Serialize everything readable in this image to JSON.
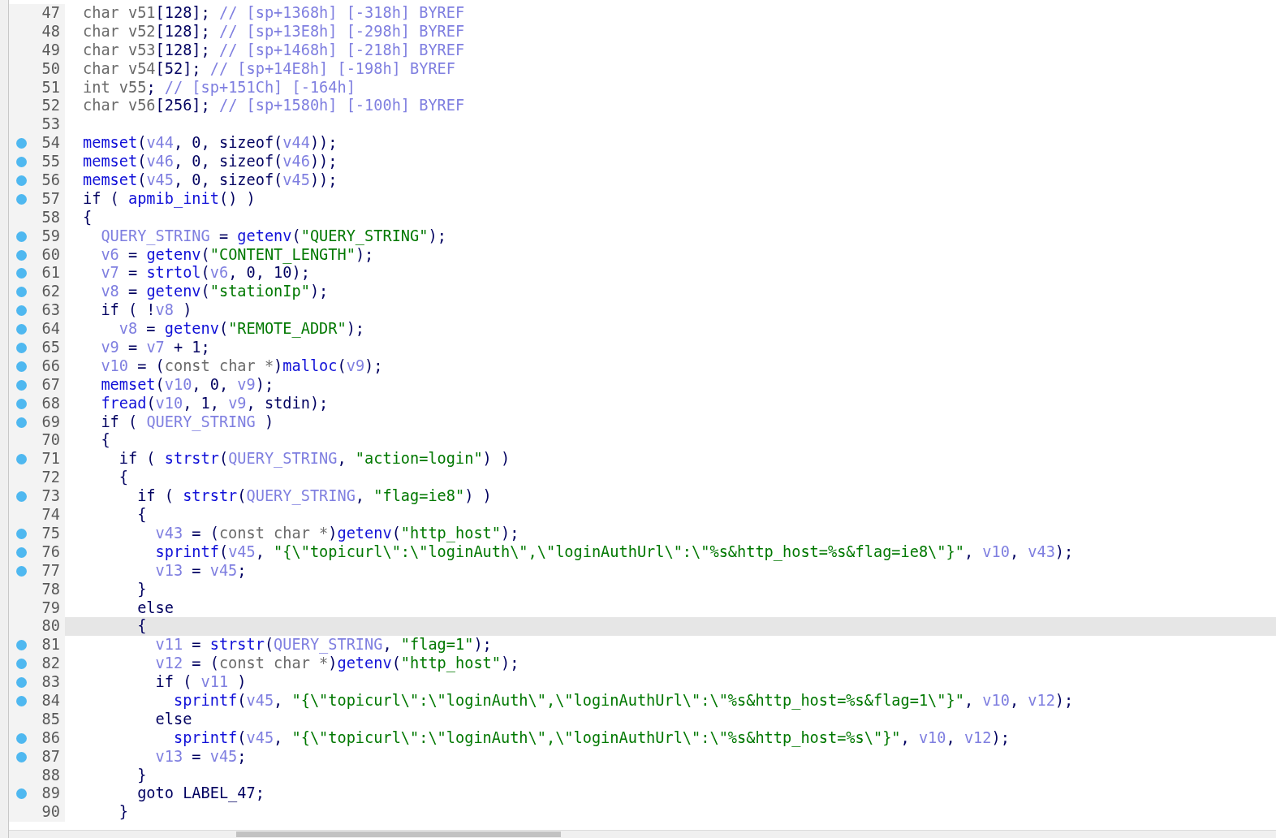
{
  "lines": [
    {
      "number": "47",
      "breakpoint": false,
      "selected": false,
      "code": [
        {
          "kind": "type",
          "text": "char v51"
        },
        {
          "kind": "plain",
          "text": "[128]; "
        },
        {
          "kind": "comment",
          "text": "// [sp+1368h] [-318h] BYREF"
        }
      ]
    },
    {
      "number": "48",
      "breakpoint": false,
      "selected": false,
      "code": [
        {
          "kind": "type",
          "text": "char v52"
        },
        {
          "kind": "plain",
          "text": "[128]; "
        },
        {
          "kind": "comment",
          "text": "// [sp+13E8h] [-298h] BYREF"
        }
      ]
    },
    {
      "number": "49",
      "breakpoint": false,
      "selected": false,
      "code": [
        {
          "kind": "type",
          "text": "char v53"
        },
        {
          "kind": "plain",
          "text": "[128]; "
        },
        {
          "kind": "comment",
          "text": "// [sp+1468h] [-218h] BYREF"
        }
      ]
    },
    {
      "number": "50",
      "breakpoint": false,
      "selected": false,
      "code": [
        {
          "kind": "type",
          "text": "char v54"
        },
        {
          "kind": "plain",
          "text": "[52]; "
        },
        {
          "kind": "comment",
          "text": "// [sp+14E8h] [-198h] BYREF"
        }
      ]
    },
    {
      "number": "51",
      "breakpoint": false,
      "selected": false,
      "code": [
        {
          "kind": "type",
          "text": "int v55"
        },
        {
          "kind": "plain",
          "text": "; "
        },
        {
          "kind": "comment",
          "text": "// [sp+151Ch] [-164h]"
        }
      ]
    },
    {
      "number": "52",
      "breakpoint": false,
      "selected": false,
      "code": [
        {
          "kind": "type",
          "text": "char v56"
        },
        {
          "kind": "plain",
          "text": "[256]; "
        },
        {
          "kind": "comment",
          "text": "// [sp+1580h] [-100h] BYREF"
        }
      ]
    },
    {
      "number": "53",
      "breakpoint": false,
      "selected": false
    },
    {
      "number": "54",
      "breakpoint": true,
      "selected": false,
      "code": [
        {
          "kind": "func",
          "text": "memset"
        },
        {
          "kind": "plain",
          "text": "("
        },
        {
          "kind": "var",
          "text": "v44"
        },
        {
          "kind": "plain",
          "text": ", 0, sizeof("
        },
        {
          "kind": "var",
          "text": "v44"
        },
        {
          "kind": "plain",
          "text": "));"
        }
      ]
    },
    {
      "number": "55",
      "breakpoint": true,
      "selected": false,
      "code": [
        {
          "kind": "func",
          "text": "memset"
        },
        {
          "kind": "plain",
          "text": "("
        },
        {
          "kind": "var",
          "text": "v46"
        },
        {
          "kind": "plain",
          "text": ", 0, sizeof("
        },
        {
          "kind": "var",
          "text": "v46"
        },
        {
          "kind": "plain",
          "text": "));"
        }
      ]
    },
    {
      "number": "56",
      "breakpoint": true,
      "selected": false,
      "code": [
        {
          "kind": "func",
          "text": "memset"
        },
        {
          "kind": "plain",
          "text": "("
        },
        {
          "kind": "var",
          "text": "v45"
        },
        {
          "kind": "plain",
          "text": ", 0, sizeof("
        },
        {
          "kind": "var",
          "text": "v45"
        },
        {
          "kind": "plain",
          "text": "));"
        }
      ]
    },
    {
      "number": "57",
      "breakpoint": true,
      "selected": false,
      "code": [
        {
          "kind": "plain",
          "text": "if ( "
        },
        {
          "kind": "func",
          "text": "apmib_init"
        },
        {
          "kind": "plain",
          "text": "() )"
        }
      ]
    },
    {
      "number": "58",
      "breakpoint": false,
      "selected": false,
      "code": [
        {
          "kind": "plain",
          "text": "{"
        }
      ]
    },
    {
      "number": "59",
      "breakpoint": true,
      "selected": false,
      "code": [
        {
          "kind": "var",
          "text": "  QUERY_STRING"
        },
        {
          "kind": "plain",
          "text": " = "
        },
        {
          "kind": "func",
          "text": "getenv"
        },
        {
          "kind": "plain",
          "text": "("
        },
        {
          "kind": "str",
          "text": "\"QUERY_STRING\""
        },
        {
          "kind": "plain",
          "text": ");"
        }
      ]
    },
    {
      "number": "60",
      "breakpoint": true,
      "selected": false,
      "code": [
        {
          "kind": "var",
          "text": "  v6"
        },
        {
          "kind": "plain",
          "text": " = "
        },
        {
          "kind": "func",
          "text": "getenv"
        },
        {
          "kind": "plain",
          "text": "("
        },
        {
          "kind": "str",
          "text": "\"CONTENT_LENGTH\""
        },
        {
          "kind": "plain",
          "text": ");"
        }
      ]
    },
    {
      "number": "61",
      "breakpoint": true,
      "selected": false,
      "code": [
        {
          "kind": "var",
          "text": "  v7"
        },
        {
          "kind": "plain",
          "text": " = "
        },
        {
          "kind": "func",
          "text": "strtol"
        },
        {
          "kind": "plain",
          "text": "("
        },
        {
          "kind": "var",
          "text": "v6"
        },
        {
          "kind": "plain",
          "text": ", 0, 10);"
        }
      ]
    },
    {
      "number": "62",
      "breakpoint": true,
      "selected": false,
      "code": [
        {
          "kind": "var",
          "text": "  v8"
        },
        {
          "kind": "plain",
          "text": " = "
        },
        {
          "kind": "func",
          "text": "getenv"
        },
        {
          "kind": "plain",
          "text": "("
        },
        {
          "kind": "str",
          "text": "\"stationIp\""
        },
        {
          "kind": "plain",
          "text": ");"
        }
      ]
    },
    {
      "number": "63",
      "breakpoint": true,
      "selected": false,
      "code": [
        {
          "kind": "plain",
          "text": "  if ( !"
        },
        {
          "kind": "var",
          "text": "v8"
        },
        {
          "kind": "plain",
          "text": " )"
        }
      ]
    },
    {
      "number": "64",
      "breakpoint": true,
      "selected": false,
      "code": [
        {
          "kind": "var",
          "text": "    v8"
        },
        {
          "kind": "plain",
          "text": " = "
        },
        {
          "kind": "func",
          "text": "getenv"
        },
        {
          "kind": "plain",
          "text": "("
        },
        {
          "kind": "str",
          "text": "\"REMOTE_ADDR\""
        },
        {
          "kind": "plain",
          "text": ");"
        }
      ]
    },
    {
      "number": "65",
      "breakpoint": true,
      "selected": false,
      "code": [
        {
          "kind": "var",
          "text": "  v9"
        },
        {
          "kind": "plain",
          "text": " = "
        },
        {
          "kind": "var",
          "text": "v7"
        },
        {
          "kind": "plain",
          "text": " + 1;"
        }
      ]
    },
    {
      "number": "66",
      "breakpoint": true,
      "selected": false,
      "code": [
        {
          "kind": "var",
          "text": "  v10"
        },
        {
          "kind": "plain",
          "text": " = ("
        },
        {
          "kind": "type",
          "text": "const char *"
        },
        {
          "kind": "plain",
          "text": ")"
        },
        {
          "kind": "func",
          "text": "malloc"
        },
        {
          "kind": "plain",
          "text": "("
        },
        {
          "kind": "var",
          "text": "v9"
        },
        {
          "kind": "plain",
          "text": ");"
        }
      ]
    },
    {
      "number": "67",
      "breakpoint": true,
      "selected": false,
      "code": [
        {
          "kind": "func",
          "text": "  memset"
        },
        {
          "kind": "plain",
          "text": "("
        },
        {
          "kind": "var",
          "text": "v10"
        },
        {
          "kind": "plain",
          "text": ", 0, "
        },
        {
          "kind": "var",
          "text": "v9"
        },
        {
          "kind": "plain",
          "text": ");"
        }
      ]
    },
    {
      "number": "68",
      "breakpoint": true,
      "selected": false,
      "code": [
        {
          "kind": "func",
          "text": "  fread"
        },
        {
          "kind": "plain",
          "text": "("
        },
        {
          "kind": "var",
          "text": "v10"
        },
        {
          "kind": "plain",
          "text": ", 1, "
        },
        {
          "kind": "var",
          "text": "v9"
        },
        {
          "kind": "plain",
          "text": ", stdin);"
        }
      ]
    },
    {
      "number": "69",
      "breakpoint": true,
      "selected": false,
      "code": [
        {
          "kind": "plain",
          "text": "  if ( "
        },
        {
          "kind": "var",
          "text": "QUERY_STRING"
        },
        {
          "kind": "plain",
          "text": " )"
        }
      ]
    },
    {
      "number": "70",
      "breakpoint": false,
      "selected": false,
      "code": [
        {
          "kind": "plain",
          "text": "  {"
        }
      ]
    },
    {
      "number": "71",
      "breakpoint": true,
      "selected": false,
      "code": [
        {
          "kind": "plain",
          "text": "    if ( "
        },
        {
          "kind": "func",
          "text": "strstr"
        },
        {
          "kind": "plain",
          "text": "("
        },
        {
          "kind": "var",
          "text": "QUERY_STRING"
        },
        {
          "kind": "plain",
          "text": ", "
        },
        {
          "kind": "str",
          "text": "\"action=login\""
        },
        {
          "kind": "plain",
          "text": ") )"
        }
      ]
    },
    {
      "number": "72",
      "breakpoint": false,
      "selected": false,
      "code": [
        {
          "kind": "plain",
          "text": "    {"
        }
      ]
    },
    {
      "number": "73",
      "breakpoint": true,
      "selected": false,
      "code": [
        {
          "kind": "plain",
          "text": "      if ( "
        },
        {
          "kind": "func",
          "text": "strstr"
        },
        {
          "kind": "plain",
          "text": "("
        },
        {
          "kind": "var",
          "text": "QUERY_STRING"
        },
        {
          "kind": "plain",
          "text": ", "
        },
        {
          "kind": "str",
          "text": "\"flag=ie8\""
        },
        {
          "kind": "plain",
          "text": ") )"
        }
      ]
    },
    {
      "number": "74",
      "breakpoint": false,
      "selected": false,
      "code": [
        {
          "kind": "plain",
          "text": "      {"
        }
      ]
    },
    {
      "number": "75",
      "breakpoint": true,
      "selected": false,
      "code": [
        {
          "kind": "var",
          "text": "        v43"
        },
        {
          "kind": "plain",
          "text": " = ("
        },
        {
          "kind": "type",
          "text": "const char *"
        },
        {
          "kind": "plain",
          "text": ")"
        },
        {
          "kind": "func",
          "text": "getenv"
        },
        {
          "kind": "plain",
          "text": "("
        },
        {
          "kind": "str",
          "text": "\"http_host\""
        },
        {
          "kind": "plain",
          "text": ");"
        }
      ]
    },
    {
      "number": "76",
      "breakpoint": true,
      "selected": false,
      "code": [
        {
          "kind": "func",
          "text": "        sprintf"
        },
        {
          "kind": "plain",
          "text": "("
        },
        {
          "kind": "var",
          "text": "v45"
        },
        {
          "kind": "plain",
          "text": ", "
        },
        {
          "kind": "str",
          "text": "\"{\\\"topicurl\\\":\\\"loginAuth\\\",\\\"loginAuthUrl\\\":\\\"%s&http_host=%s&flag=ie8\\\"}\""
        },
        {
          "kind": "plain",
          "text": ", "
        },
        {
          "kind": "var",
          "text": "v10"
        },
        {
          "kind": "plain",
          "text": ", "
        },
        {
          "kind": "var",
          "text": "v43"
        },
        {
          "kind": "plain",
          "text": ");"
        }
      ]
    },
    {
      "number": "77",
      "breakpoint": true,
      "selected": false,
      "code": [
        {
          "kind": "var",
          "text": "        v13"
        },
        {
          "kind": "plain",
          "text": " = "
        },
        {
          "kind": "var",
          "text": "v45"
        },
        {
          "kind": "plain",
          "text": ";"
        }
      ]
    },
    {
      "number": "78",
      "breakpoint": false,
      "selected": false,
      "code": [
        {
          "kind": "plain",
          "text": "      }"
        }
      ]
    },
    {
      "number": "79",
      "breakpoint": false,
      "selected": false,
      "code": [
        {
          "kind": "plain",
          "text": "      else"
        }
      ]
    },
    {
      "number": "80",
      "breakpoint": false,
      "selected": true,
      "code": [
        {
          "kind": "plain",
          "text": "      {"
        }
      ]
    },
    {
      "number": "81",
      "breakpoint": true,
      "selected": false,
      "code": [
        {
          "kind": "var",
          "text": "        v11"
        },
        {
          "kind": "plain",
          "text": " = "
        },
        {
          "kind": "func",
          "text": "strstr"
        },
        {
          "kind": "plain",
          "text": "("
        },
        {
          "kind": "var",
          "text": "QUERY_STRING"
        },
        {
          "kind": "plain",
          "text": ", "
        },
        {
          "kind": "str",
          "text": "\"flag=1\""
        },
        {
          "kind": "plain",
          "text": ");"
        }
      ]
    },
    {
      "number": "82",
      "breakpoint": true,
      "selected": false,
      "code": [
        {
          "kind": "var",
          "text": "        v12"
        },
        {
          "kind": "plain",
          "text": " = ("
        },
        {
          "kind": "type",
          "text": "const char *"
        },
        {
          "kind": "plain",
          "text": ")"
        },
        {
          "kind": "func",
          "text": "getenv"
        },
        {
          "kind": "plain",
          "text": "("
        },
        {
          "kind": "str",
          "text": "\"http_host\""
        },
        {
          "kind": "plain",
          "text": ");"
        }
      ]
    },
    {
      "number": "83",
      "breakpoint": true,
      "selected": false,
      "code": [
        {
          "kind": "plain",
          "text": "        if ( "
        },
        {
          "kind": "var",
          "text": "v11"
        },
        {
          "kind": "plain",
          "text": " )"
        }
      ]
    },
    {
      "number": "84",
      "breakpoint": true,
      "selected": false,
      "code": [
        {
          "kind": "func",
          "text": "          sprintf"
        },
        {
          "kind": "plain",
          "text": "("
        },
        {
          "kind": "var",
          "text": "v45"
        },
        {
          "kind": "plain",
          "text": ", "
        },
        {
          "kind": "str",
          "text": "\"{\\\"topicurl\\\":\\\"loginAuth\\\",\\\"loginAuthUrl\\\":\\\"%s&http_host=%s&flag=1\\\"}\""
        },
        {
          "kind": "plain",
          "text": ", "
        },
        {
          "kind": "var",
          "text": "v10"
        },
        {
          "kind": "plain",
          "text": ", "
        },
        {
          "kind": "var",
          "text": "v12"
        },
        {
          "kind": "plain",
          "text": ");"
        }
      ]
    },
    {
      "number": "85",
      "breakpoint": false,
      "selected": false,
      "code": [
        {
          "kind": "plain",
          "text": "        else"
        }
      ]
    },
    {
      "number": "86",
      "breakpoint": true,
      "selected": false,
      "code": [
        {
          "kind": "func",
          "text": "          sprintf"
        },
        {
          "kind": "plain",
          "text": "("
        },
        {
          "kind": "var",
          "text": "v45"
        },
        {
          "kind": "plain",
          "text": ", "
        },
        {
          "kind": "str",
          "text": "\"{\\\"topicurl\\\":\\\"loginAuth\\\",\\\"loginAuthUrl\\\":\\\"%s&http_host=%s\\\"}\""
        },
        {
          "kind": "plain",
          "text": ", "
        },
        {
          "kind": "var",
          "text": "v10"
        },
        {
          "kind": "plain",
          "text": ", "
        },
        {
          "kind": "var",
          "text": "v12"
        },
        {
          "kind": "plain",
          "text": ");"
        }
      ]
    },
    {
      "number": "87",
      "breakpoint": true,
      "selected": false,
      "code": [
        {
          "kind": "var",
          "text": "        v13"
        },
        {
          "kind": "plain",
          "text": " = "
        },
        {
          "kind": "var",
          "text": "v45"
        },
        {
          "kind": "plain",
          "text": ";"
        }
      ]
    },
    {
      "number": "88",
      "breakpoint": false,
      "selected": false,
      "code": [
        {
          "kind": "plain",
          "text": "      }"
        }
      ]
    },
    {
      "number": "89",
      "breakpoint": true,
      "selected": false,
      "code": [
        {
          "kind": "plain",
          "text": "      goto LABEL_47;"
        }
      ]
    },
    {
      "number": "90",
      "breakpoint": false,
      "selected": false,
      "code": [
        {
          "kind": "plain",
          "text": "    }"
        }
      ]
    }
  ]
}
